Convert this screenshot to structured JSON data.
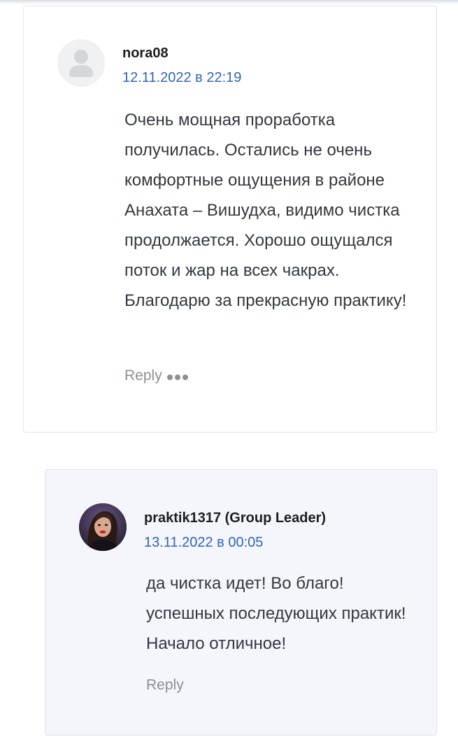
{
  "comments": [
    {
      "author": "nora08",
      "date": "12.11.2022 в 22:19",
      "body": "Очень мощная проработка получилась. Остались не очень комфортные ощущения в районе Анахата – Вишудха, видимо чистка продолжается. Хорошо ощущался поток и жар на всех чакрах. Благодарю за прекрасную практику!",
      "reply_label": "Reply",
      "avatar_icon": "default-user-icon",
      "more_icon": "more-dots-icon"
    },
    {
      "author": "praktik1317 (Group Leader)",
      "date": "13.11.2022 в 00:05",
      "body": "да чистка идет! Во благо! успешных последующих практик! Начало отличное!",
      "reply_label": "Reply",
      "avatar_icon": "user-photo-avatar"
    }
  ],
  "colors": {
    "date_link": "#2f66b3",
    "reply_background": "#f5f5fc",
    "muted_text": "#8d9096"
  }
}
